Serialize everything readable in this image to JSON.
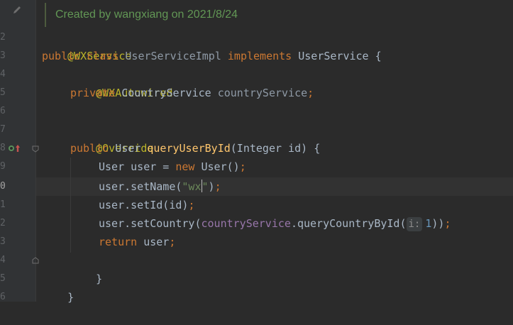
{
  "editor": {
    "comment": "Created by wangxiang on 2021/8/24",
    "line_numbers": [
      "2",
      "3",
      "4",
      "5",
      "6",
      "7",
      "8",
      "9",
      "0",
      "1",
      "2",
      "3",
      "4",
      "5",
      "6"
    ],
    "lines": {
      "l2": {
        "ann": "@WXService"
      },
      "l3": {
        "kw1": "public",
        "kw2": "class",
        "cls": "UserServiceImpl",
        "kw3": "implements",
        "iface": "UserService",
        "brace": "{"
      },
      "l4": {
        "ann": "@WXAutowired"
      },
      "l5": {
        "kw": "private",
        "type": "CountryService",
        "field": "countryService",
        "semi": ";"
      },
      "l7": {
        "ann": "@Override"
      },
      "l8": {
        "kw": "public",
        "type": "User",
        "method": "queryUserById",
        "params_open": "(Integer id)",
        "brace": "{"
      },
      "l9": {
        "t1": "User user = ",
        "kw": "new",
        "t2": "User()",
        "semi": ";"
      },
      "l10": {
        "t1": "user.setName(",
        "str1": "\"wx",
        "str2": "\"",
        "t2": ")",
        "semi": ";"
      },
      "l11": {
        "t1": "user.setId(id)",
        "semi": ";"
      },
      "l12": {
        "t1": "user.setCountry(",
        "field": "countryService",
        "t2": ".queryCountryById(",
        "hint_label": "i:",
        "hint_value": "1",
        "t3": "))",
        "semi": ";"
      },
      "l13": {
        "kw": "return",
        "t1": " user",
        "semi": ";"
      },
      "l14": {
        "brace": "}"
      },
      "l15": {
        "brace": "}"
      }
    }
  },
  "colors": {
    "background": "#2b2b2b",
    "keyword": "#cc7832",
    "annotation": "#bbb529",
    "field": "#9876aa",
    "method_declaration": "#ffc66d",
    "string": "#6a8759",
    "number": "#6897bb",
    "comment": "#629755"
  }
}
